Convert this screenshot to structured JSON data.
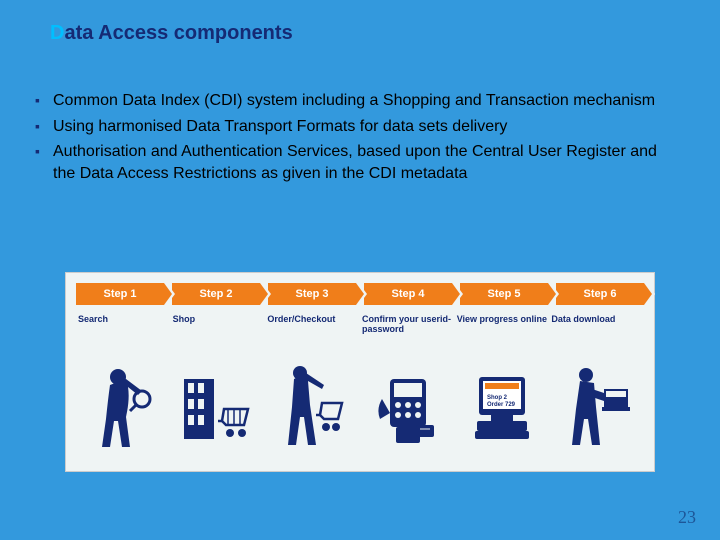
{
  "title": {
    "accent": "D",
    "rest": "ata Access components"
  },
  "bullets": [
    "Common Data Index (CDI) system including a Shopping and Transaction mechanism",
    "Using harmonised Data Transport Formats for data sets delivery",
    "Authorisation and Authentication Services, based upon the Central User Register and the Data Access Restrictions as given in the CDI metadata"
  ],
  "steps": [
    {
      "label": "Step 1",
      "caption": "Search"
    },
    {
      "label": "Step 2",
      "caption": "Shop"
    },
    {
      "label": "Step 3",
      "caption": "Order/Checkout"
    },
    {
      "label": "Step 4",
      "caption": "Confirm your userid-password"
    },
    {
      "label": "Step 5",
      "caption": "View progress online"
    },
    {
      "label": "Step 6",
      "caption": "Data download"
    }
  ],
  "page_number": "23"
}
